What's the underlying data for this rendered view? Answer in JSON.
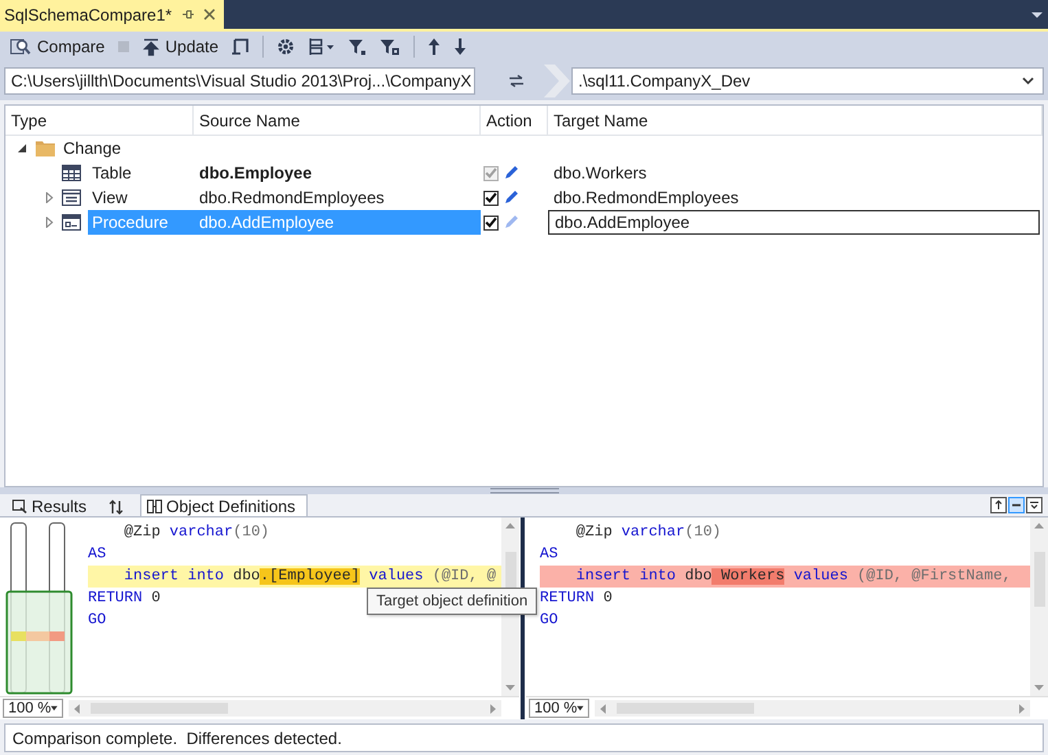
{
  "document_tab": {
    "title": "SqlSchemaCompare1*"
  },
  "toolbar": {
    "compare_label": "Compare",
    "update_label": "Update",
    "stop": {
      "disabled": true
    }
  },
  "source": {
    "value": "C:\\Users\\jillth\\Documents\\Visual Studio 2013\\Proj...\\CompanyX"
  },
  "target": {
    "value": ".\\sql11.CompanyX_Dev"
  },
  "grid": {
    "columns": [
      "Type",
      "Source Name",
      "Action",
      "Target Name"
    ],
    "groups": [
      {
        "label": "Change",
        "expanded": true,
        "children": [
          {
            "kind": "table",
            "type": "Table",
            "source": "dbo.Employee",
            "target": "dbo.Workers",
            "emphasized": true,
            "included": true,
            "disabled": true,
            "selected": false
          },
          {
            "kind": "view",
            "type": "View",
            "source": "dbo.RedmondEmployees",
            "target": "dbo.RedmondEmployees",
            "emphasized": false,
            "included": true,
            "disabled": false,
            "selected": false,
            "expanded": false
          },
          {
            "kind": "procedure",
            "type": "Procedure",
            "source": "dbo.AddEmployee",
            "target": "dbo.AddEmployee",
            "emphasized": false,
            "included": true,
            "disabled": false,
            "selected": true,
            "expanded": false
          }
        ]
      }
    ]
  },
  "bottom_panel": {
    "tabs": [
      {
        "kind": "results",
        "label": "Results",
        "selected": false
      },
      {
        "kind": "sort",
        "selected": false
      },
      {
        "kind": "definitions",
        "label": "Object Definitions",
        "selected": true
      }
    ],
    "layout_buttons": [
      {
        "selected": false
      },
      {
        "selected": true
      },
      {
        "selected": false
      }
    ],
    "panes": [
      {
        "kind": "source",
        "zoom": "100 %",
        "lines": [
          {
            "indented": true,
            "changed": false,
            "tokens": [
              {
                "text": "@Zip ",
                "kind": "plain"
              },
              {
                "text": "varchar",
                "kind": "keyword"
              },
              {
                "text": "(10)",
                "kind": "muted"
              }
            ]
          },
          {
            "indented": false,
            "changed": false,
            "tokens": [
              {
                "text": "AS",
                "kind": "keyword"
              }
            ]
          },
          {
            "indented": true,
            "changed": true,
            "tokens": [
              {
                "text": "insert into ",
                "kind": "keyword"
              },
              {
                "text": "dbo",
                "kind": "plain"
              },
              {
                "text": ".[Employee]",
                "kind": "diff"
              },
              {
                "text": " values ",
                "kind": "keyword"
              },
              {
                "text": "(@ID, @",
                "kind": "muted"
              }
            ]
          },
          {
            "indented": false,
            "changed": false,
            "tokens": [
              {
                "text": "RETURN ",
                "kind": "keyword"
              },
              {
                "text": "0",
                "kind": "plain"
              }
            ]
          },
          {
            "indented": false,
            "changed": false,
            "tokens": [
              {
                "text": "GO",
                "kind": "keyword"
              }
            ]
          }
        ]
      },
      {
        "kind": "target",
        "zoom": "100 %",
        "lines": [
          {
            "indented": true,
            "changed": false,
            "tokens": [
              {
                "text": "@Zip ",
                "kind": "plain"
              },
              {
                "text": "varchar",
                "kind": "keyword"
              },
              {
                "text": "(10)",
                "kind": "muted"
              }
            ]
          },
          {
            "indented": false,
            "changed": false,
            "tokens": [
              {
                "text": "AS",
                "kind": "keyword"
              }
            ]
          },
          {
            "indented": true,
            "changed": true,
            "tokens": [
              {
                "text": "insert into ",
                "kind": "keyword"
              },
              {
                "text": "dbo",
                "kind": "plain"
              },
              {
                "text": " Workers",
                "kind": "diff"
              },
              {
                "text": " values ",
                "kind": "keyword"
              },
              {
                "text": "(@ID, @FirstName,",
                "kind": "muted"
              }
            ]
          },
          {
            "indented": false,
            "changed": false,
            "tokens": [
              {
                "text": "RETURN ",
                "kind": "keyword"
              },
              {
                "text": "0",
                "kind": "plain"
              }
            ]
          },
          {
            "indented": false,
            "changed": false,
            "tokens": [
              {
                "text": "GO",
                "kind": "keyword"
              }
            ]
          }
        ]
      }
    ],
    "tooltip": {
      "text": "Target object definition"
    }
  },
  "status_bar": {
    "text": "Comparison complete.  Differences detected."
  }
}
